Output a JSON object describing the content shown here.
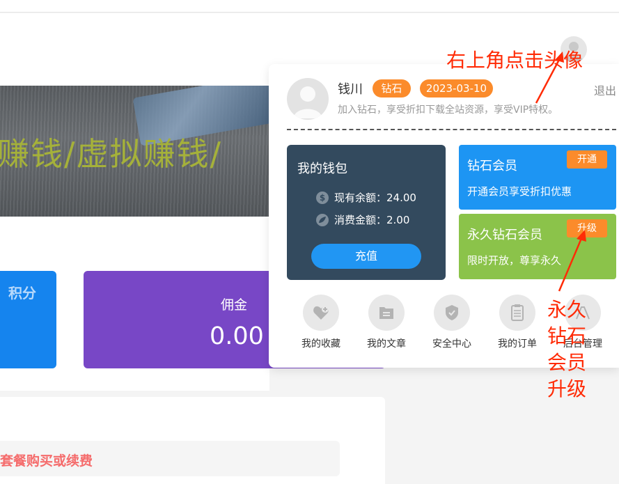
{
  "banner": {
    "text": "赚钱/虚拟赚钱/"
  },
  "stats": {
    "points_label": "积分",
    "commission_label": "佣金",
    "commission_value": "0.00"
  },
  "notice": {
    "text": "套餐购买或续费"
  },
  "user": {
    "name": "钱川",
    "level_badge": "钻石",
    "date_badge": "2023-03-10",
    "logout": "退出",
    "description": "加入钻石，享受折扣下载全站资源，享受VIP特权。"
  },
  "wallet": {
    "title": "我的钱包",
    "balance": "现有余额：24.00",
    "spent": "消费金额：2.00",
    "recharge_button": "充值",
    "balance_icon": "dollar-coin-icon",
    "spent_icon": "leaf-icon"
  },
  "vip": {
    "diamond": {
      "title": "钻石会员",
      "button": "开通",
      "desc": "开通会员享受折扣优惠"
    },
    "forever": {
      "title": "永久钻石会员",
      "button": "升级",
      "desc": "限时开放，尊享永久"
    }
  },
  "quick_links": [
    {
      "label": "我的收藏",
      "icon": "heart-plus-icon"
    },
    {
      "label": "我的文章",
      "icon": "folder-icon"
    },
    {
      "label": "安全中心",
      "icon": "shield-check-icon"
    },
    {
      "label": "我的订单",
      "icon": "clipboard-icon"
    },
    {
      "label": "后台管理",
      "icon": "dashboard-icon"
    }
  ],
  "annotations": {
    "top": "右上角点击头像",
    "bottom": "永久钻石会员升级"
  },
  "colors": {
    "accent_orange": "#fb8b2b",
    "wallet_bg": "#334a5e",
    "vip_blue": "#1d95f3",
    "vip_green": "#8bc34a",
    "annotation_red": "#ff2b06",
    "commission_purple": "#7847c6"
  }
}
